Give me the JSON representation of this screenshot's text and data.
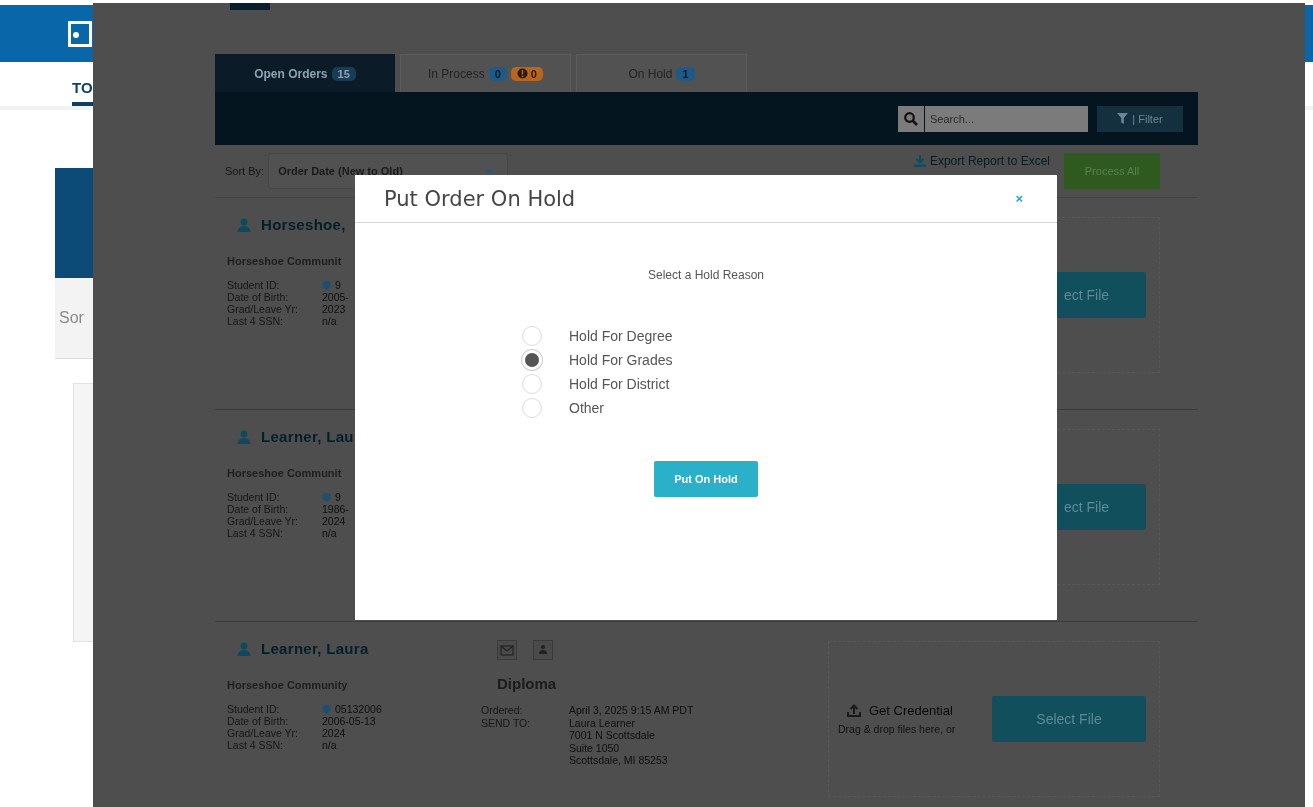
{
  "background_page": {
    "nav_tab": "TO",
    "sort_label": "Sor"
  },
  "tabs": [
    {
      "label": "Open Orders",
      "selected": true,
      "badges": [
        {
          "kind": "count",
          "text": "15"
        }
      ]
    },
    {
      "label": "In Process",
      "selected": false,
      "badges": [
        {
          "kind": "count",
          "text": "0"
        },
        {
          "kind": "alert",
          "text": "0"
        }
      ]
    },
    {
      "label": "On Hold",
      "selected": false,
      "badges": [
        {
          "kind": "count",
          "text": "1"
        }
      ]
    }
  ],
  "toolbar": {
    "search": {
      "placeholder": "Search..."
    },
    "filter_button": "| Filter"
  },
  "sort": {
    "label": "Sort By:",
    "value": "Order Date (New to Old)"
  },
  "export_link": "Export Report to Excel",
  "process_all_button": "Process All",
  "orders": [
    {
      "name": "Horseshoe,",
      "school": "Horseshoe Communit",
      "fields": [
        {
          "label": "Student ID:",
          "value": "9",
          "verified": true
        },
        {
          "label": "Date of Birth:",
          "value": "2005-"
        },
        {
          "label": "Grad/Leave Yr:",
          "value": "2023"
        },
        {
          "label": "Last 4 SSN:",
          "value": "n/a"
        }
      ],
      "select_button": "ect File"
    },
    {
      "name": "Learner, Lau",
      "school": "Horseshoe Communit",
      "fields": [
        {
          "label": "Student ID:",
          "value": "9",
          "verified": true
        },
        {
          "label": "Date of Birth:",
          "value": "1986-"
        },
        {
          "label": "Grad/Leave Yr:",
          "value": "2024"
        },
        {
          "label": "Last 4 SSN:",
          "value": "n/a"
        }
      ],
      "select_button": "ect File"
    },
    {
      "name": "Learner, Laura",
      "school": "Horseshoe Community",
      "fields": [
        {
          "label": "Student ID:",
          "value": "05132006",
          "verified": true
        },
        {
          "label": "Date of Birth:",
          "value": "2006-05-13"
        },
        {
          "label": "Grad/Leave Yr:",
          "value": "2024"
        },
        {
          "label": "Last 4 SSN:",
          "value": "n/a"
        }
      ],
      "document": {
        "title": "Diploma",
        "ordered_label": "Ordered:",
        "ordered": "April 3, 2025 9:15 AM PDT",
        "send_to_label": "SEND TO:",
        "address": [
          "Laura Learner",
          "7001 N Scottsdale",
          "Suite 1050",
          "Scottsdale, MI 85253"
        ]
      },
      "credential": {
        "title": "Get Credential",
        "hint": "Drag & drop files here, or"
      },
      "select_button": "Select File"
    }
  ],
  "modal": {
    "title": "Put Order On Hold",
    "close": "×",
    "prompt": "Select a Hold Reason",
    "reasons": [
      {
        "label": "Hold For Degree",
        "selected": false
      },
      {
        "label": "Hold For Grades",
        "selected": true
      },
      {
        "label": "Hold For District",
        "selected": false
      },
      {
        "label": "Other",
        "selected": false
      }
    ],
    "button": "Put On Hold"
  }
}
